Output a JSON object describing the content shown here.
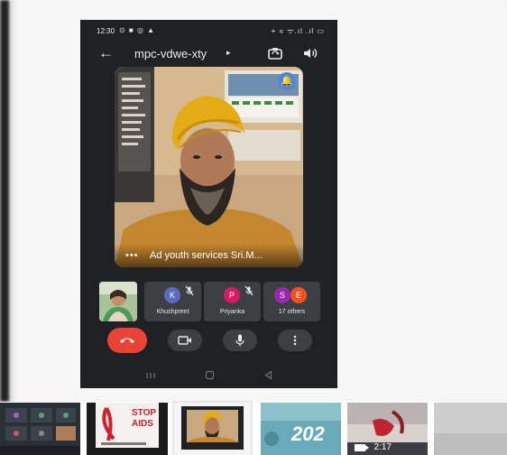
{
  "status_bar": {
    "time": "12:30",
    "left_icons": "⊙ ■ ◎ ▲",
    "right_icons": "⌖ ≋ ᯤ.ıl .ıl ▭"
  },
  "call_header": {
    "meeting_code": "mpc-vdwe-xty",
    "caret": "▸"
  },
  "main_video": {
    "speaker_label": "Ad youth services Sri.M...",
    "dots": "•••"
  },
  "participants": [
    {
      "initial": "K",
      "name": "Khushpreet",
      "color": "#5c6bc0"
    },
    {
      "initial": "P",
      "name": "Priyanka",
      "color": "#d81b60"
    },
    {
      "initials": [
        "S",
        "E"
      ],
      "name": "17 others",
      "colors": [
        "#9c27b0",
        "#f4511e"
      ]
    }
  ],
  "thumbnails": {
    "video_duration": "2:17",
    "stop_aids_line1": "STOP",
    "stop_aids_line2": "AIDS",
    "year_text": "202"
  },
  "colors": {
    "end_call": "#ea4335",
    "bell_bg": "#4f86d9",
    "call_bg": "#202124",
    "tile_bg": "#3c4043"
  }
}
